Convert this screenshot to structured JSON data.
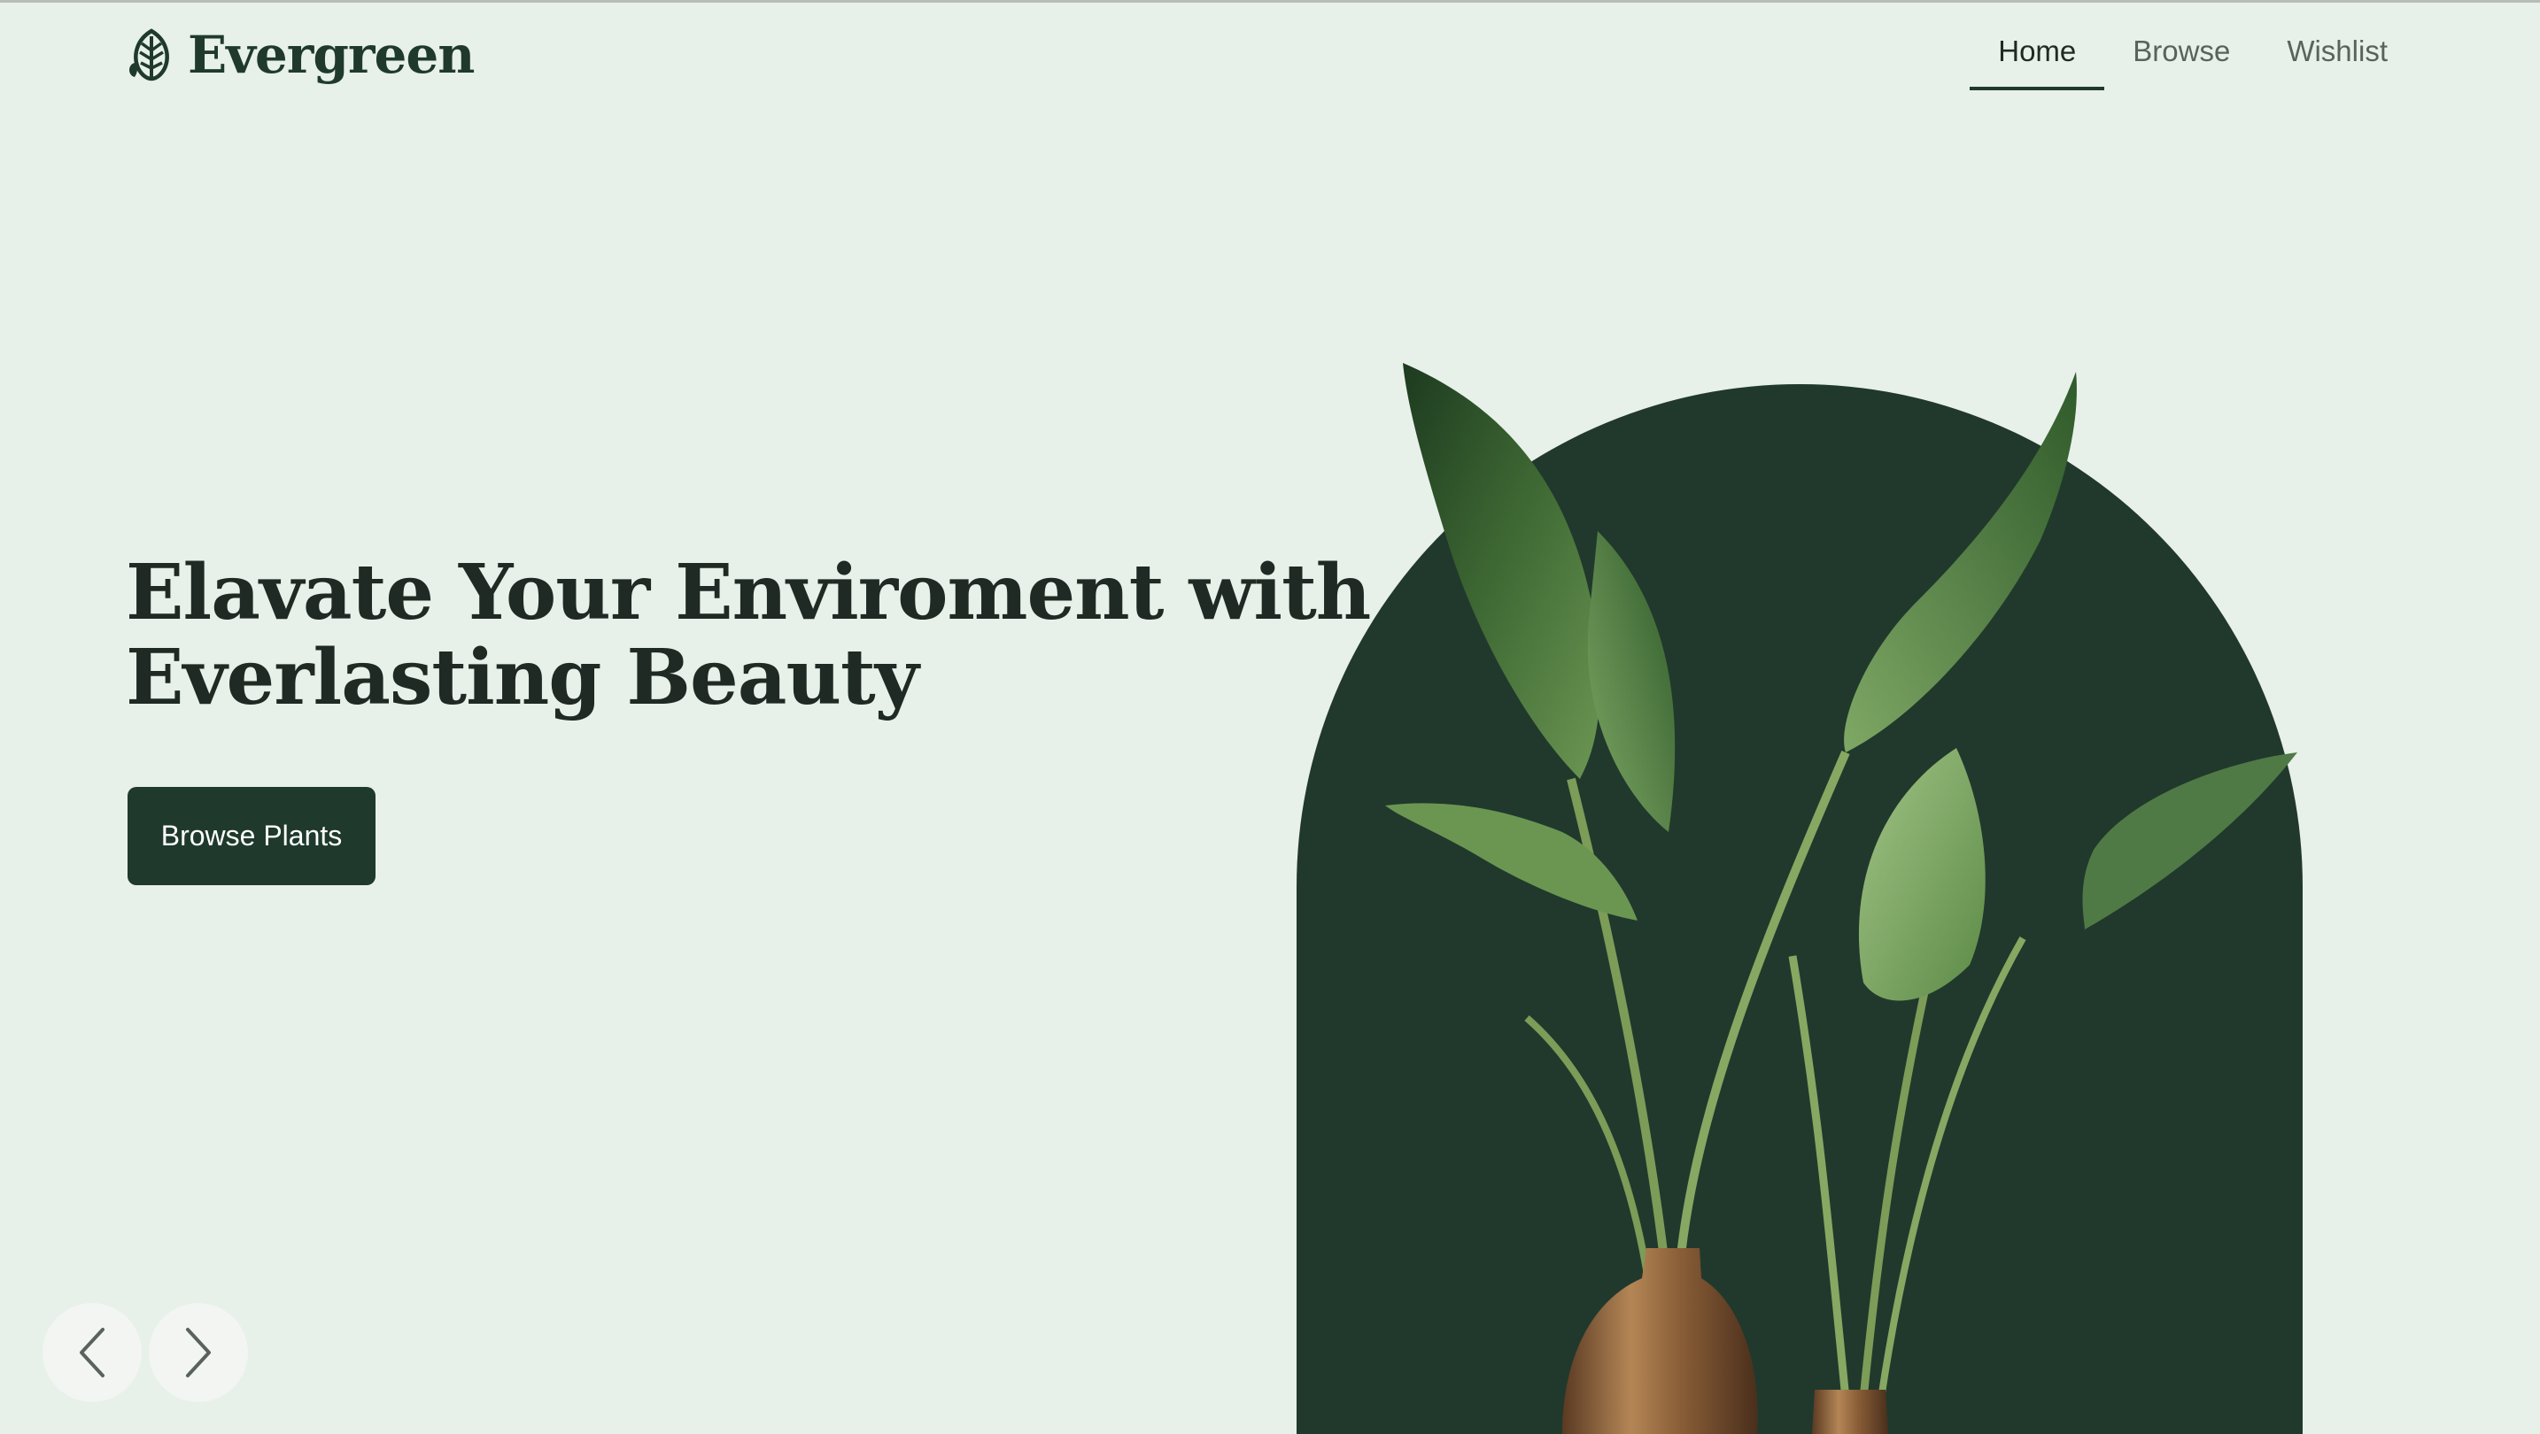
{
  "brand": {
    "name": "Evergreen",
    "logo_icon": "leaf-icon",
    "color": "#1f3a2c"
  },
  "nav": {
    "items": [
      {
        "label": "Home",
        "active": true
      },
      {
        "label": "Browse",
        "active": false
      },
      {
        "label": "Wishlist",
        "active": false
      }
    ]
  },
  "hero": {
    "headline_line1": "Elavate Your Enviroment with",
    "headline_line2": "Everlasting Beauty",
    "cta_label": "Browse Plants",
    "image": "potted-plant-image",
    "arch_color": "#21392c"
  },
  "carousel": {
    "prev_icon": "chevron-left-icon",
    "next_icon": "chevron-right-icon"
  },
  "colors": {
    "background": "#e7f0e9",
    "accent": "#1f3a2c",
    "text": "#1f2a24",
    "muted": "#5a625d"
  }
}
